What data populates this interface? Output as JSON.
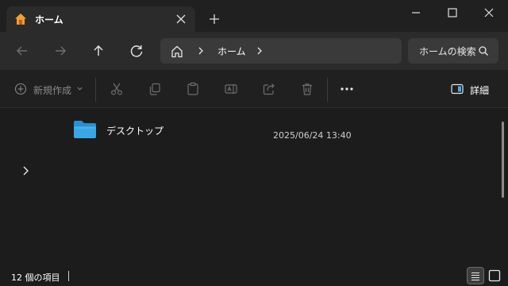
{
  "tab": {
    "title": "ホーム",
    "icon": "home-icon",
    "accent": "#f0a030"
  },
  "navigation": {
    "breadcrumb": [
      "ホーム"
    ],
    "search_placeholder": "ホームの検索"
  },
  "commands": {
    "new_label": "新規作成",
    "details_label": "詳細"
  },
  "files": [
    {
      "name": "デスクトップ",
      "modified": "2025/06/24 13:40",
      "icon": "folder-icon",
      "icon_color": "#3aa6e6"
    }
  ],
  "status": {
    "item_count": "12 個の項目"
  },
  "colors": {
    "background": "#1c1c1c",
    "toolbar": "#2b2b2b",
    "field": "#3a3a3a",
    "folder": "#3aa6e6"
  }
}
